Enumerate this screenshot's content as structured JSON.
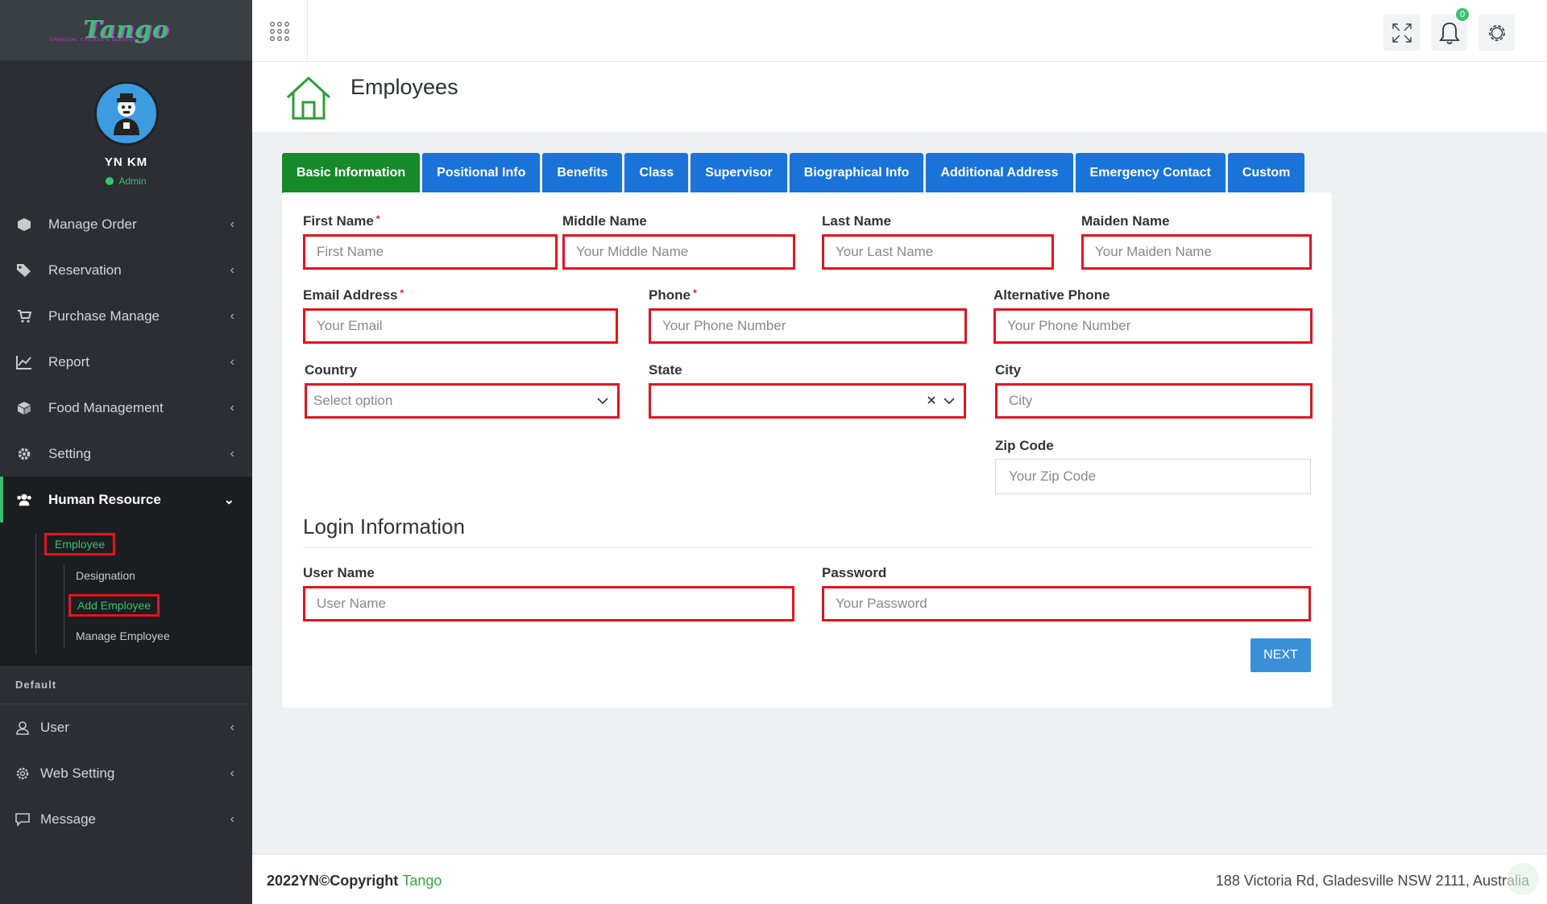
{
  "app": {
    "logo_text": "Tango",
    "logo_subtext": "CHARCOAL CHICKEN & SEAFOOD",
    "user_name": "YN KM",
    "user_role": "Admin",
    "brand_color": "#38c172"
  },
  "sidebar": {
    "items": [
      {
        "label": "Manage Order",
        "icon": "cube-icon"
      },
      {
        "label": "Reservation",
        "icon": "tag-icon"
      },
      {
        "label": "Purchase Manage",
        "icon": "cart-icon"
      },
      {
        "label": "Report",
        "icon": "chart-line-icon"
      },
      {
        "label": "Food Management",
        "icon": "box-icon"
      },
      {
        "label": "Setting",
        "icon": "gear-icon"
      },
      {
        "label": "Human Resource",
        "icon": "users-icon"
      }
    ],
    "hr_submenu": {
      "employee": "Employee",
      "designation": "Designation",
      "add_employee": "Add Employee",
      "manage_employee": "Manage Employee"
    },
    "section_default": "Default",
    "default_items": [
      {
        "label": "User",
        "icon": "user-icon"
      },
      {
        "label": "Web Setting",
        "icon": "gear-icon"
      },
      {
        "label": "Message",
        "icon": "message-icon"
      }
    ]
  },
  "header": {
    "notification_count": "0",
    "page_title": "Employees"
  },
  "tabs": [
    "Basic Information",
    "Positional Info",
    "Benefits",
    "Class",
    "Supervisor",
    "Biographical Info",
    "Additional Address",
    "Emergency Contact",
    "Custom"
  ],
  "form": {
    "first_name": {
      "label": "First Name",
      "placeholder": "First Name"
    },
    "middle_name": {
      "label": "Middle Name",
      "placeholder": "Your Middle Name"
    },
    "last_name": {
      "label": "Last Name",
      "placeholder": "Your Last Name"
    },
    "maiden_name": {
      "label": "Maiden Name",
      "placeholder": "Your Maiden Name"
    },
    "email": {
      "label": "Email Address",
      "placeholder": "Your Email"
    },
    "phone": {
      "label": "Phone",
      "placeholder": "Your Phone Number"
    },
    "alt_phone": {
      "label": "Alternative Phone",
      "placeholder": "Your Phone Number"
    },
    "country": {
      "label": "Country",
      "value": "Select option"
    },
    "state": {
      "label": "State",
      "value": ""
    },
    "city": {
      "label": "City",
      "placeholder": "City"
    },
    "zip": {
      "label": "Zip Code",
      "placeholder": "Your Zip Code"
    },
    "login_heading": "Login Information",
    "username": {
      "label": "User Name",
      "placeholder": "User Name"
    },
    "password": {
      "label": "Password",
      "placeholder": "Your Password"
    },
    "next_label": "NEXT",
    "required_mark": "*"
  },
  "footer": {
    "copyright": "2022YN©Copyright",
    "brand": "Tango",
    "address": "188 Victoria Rd, Gladesville NSW 2111, Australia"
  }
}
